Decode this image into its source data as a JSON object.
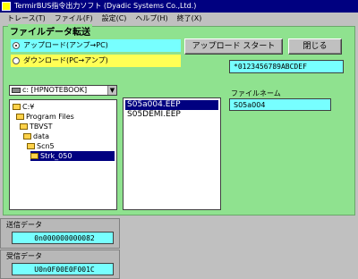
{
  "window": {
    "title": "TermirBUS指令出力ソフト (Dyadic Systems Co.,Ltd.)"
  },
  "menu": [
    "トレース(T)",
    "ファイル(F)",
    "設定(C)",
    "ヘルプ(H)",
    "終了(X)"
  ],
  "transfer": {
    "group_label": "ファイルデータ転送",
    "upload_label": "アップロード(アンプ→PC)",
    "download_label": "ダウンロード(PC→アンプ)",
    "start_button": "アップロード スタート",
    "close_button": "閉じる",
    "hex_value": "*0123456789ABCDEF",
    "drive": "c: [HPNOTEBOOK]",
    "tree": [
      "C:¥",
      "Program Files",
      "TBVST",
      "data",
      "Scn5",
      "Strk_050"
    ],
    "files": [
      "S05a004.EEP",
      "S05DEMI.EEP"
    ],
    "filename_label": "ファイルネーム",
    "filename_value": "S05a004"
  },
  "send": {
    "label": "送信データ",
    "value": "0n000000000082"
  },
  "recv": {
    "label": "受信データ",
    "value": "U0n0F00E0F001C"
  },
  "colors": {
    "green": "#8fe28f",
    "cyan": "#77ffff",
    "yellow": "#ffff55",
    "selection": "#000080"
  }
}
